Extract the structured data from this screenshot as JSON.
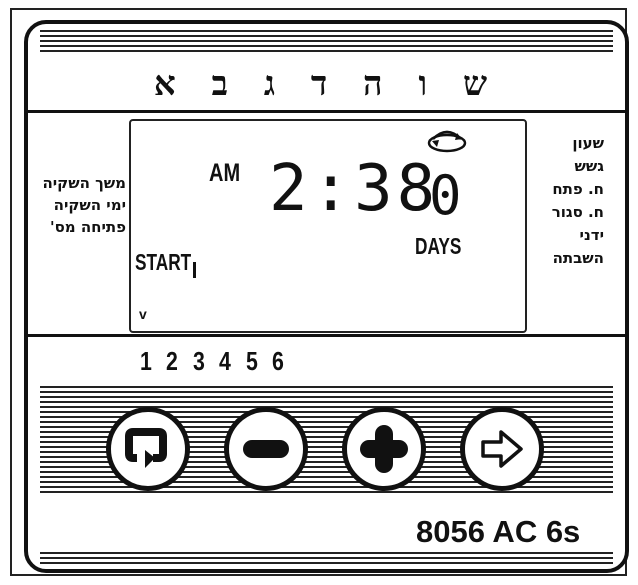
{
  "header": {
    "day_letters": "ש ו ה ד ג ב א"
  },
  "left_labels": [
    "משך השקיה",
    "ימי השקיה",
    "פתיחה מס'"
  ],
  "right_labels": [
    "שעון",
    "גשש",
    "ח. פתח",
    "ח. סגור",
    "ידני",
    "השבתה"
  ],
  "lcd": {
    "am": "AM",
    "time": "2:38",
    "days_value": "0",
    "days_label": "DAYS",
    "start_label": "START",
    "pointer": "v"
  },
  "program_numbers": [
    "1",
    "2",
    "3",
    "4",
    "5",
    "6"
  ],
  "buttons": [
    {
      "name": "cycle",
      "icon": "cycle-arrow-icon"
    },
    {
      "name": "minus",
      "icon": "minus-icon"
    },
    {
      "name": "plus",
      "icon": "plus-icon"
    },
    {
      "name": "next",
      "icon": "right-arrow-icon"
    }
  ],
  "model": "8056 AC 6s"
}
